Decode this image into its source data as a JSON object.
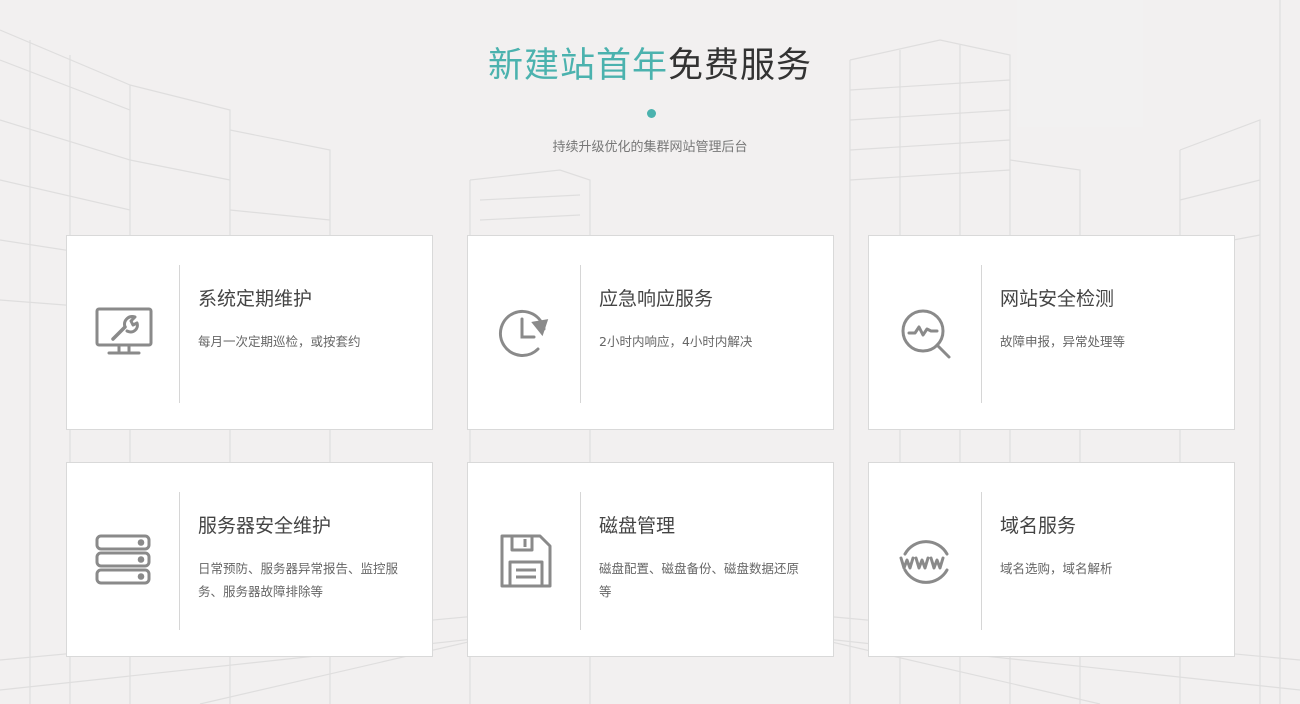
{
  "header": {
    "title_accent": "新建站首年",
    "title_rest": "免费服务",
    "subtitle": "持续升级优化的集群网站管理后台",
    "accent_color": "#4bb2ae"
  },
  "services": [
    {
      "title": "系统定期维护",
      "desc": "每月一次定期巡检，或按套约",
      "icon": "monitor-wrench-icon"
    },
    {
      "title": "应急响应服务",
      "desc": "2小时内响应，4小时内解决",
      "icon": "clock-refresh-icon"
    },
    {
      "title": "网站安全检测",
      "desc": "故障申报，异常处理等",
      "icon": "magnifier-pulse-icon"
    },
    {
      "title": "服务器安全维护",
      "desc": "日常预防、服务器异常报告、监控服务、服务器故障排除等",
      "icon": "server-stack-icon"
    },
    {
      "title": "磁盘管理",
      "desc": "磁盘配置、磁盘备份、磁盘数据还原等",
      "icon": "floppy-disk-icon"
    },
    {
      "title": "域名服务",
      "desc": "域名选购，域名解析",
      "icon": "www-globe-icon"
    }
  ]
}
